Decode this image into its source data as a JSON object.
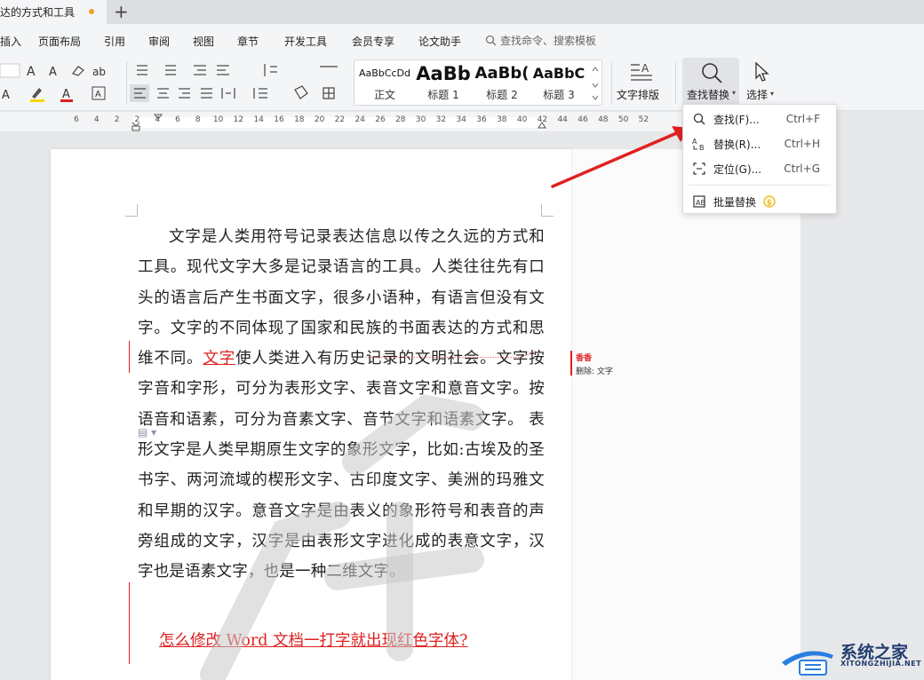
{
  "tab": {
    "title": "达的方式和工具",
    "new_tab": "+"
  },
  "menu": {
    "items": [
      "插入",
      "页面布局",
      "引用",
      "审阅",
      "视图",
      "章节",
      "开发工具",
      "会员专享",
      "论文助手"
    ],
    "search_placeholder": "查找命令、搜索模板"
  },
  "toolbar": {
    "styles": [
      {
        "sample": "AaBbCcDd",
        "name": "正文"
      },
      {
        "sample": "AaBb",
        "name": "标题 1"
      },
      {
        "sample": "AaBb(",
        "name": "标题 2"
      },
      {
        "sample": "AaBbC",
        "name": "标题 3"
      }
    ],
    "text_layout": "文字排版",
    "find_replace": "查找替换",
    "select": "选择"
  },
  "ruler": {
    "ticks": [
      "6",
      "4",
      "2",
      "2",
      "4",
      "6",
      "8",
      "10",
      "12",
      "14",
      "16",
      "18",
      "20",
      "22",
      "24",
      "26",
      "28",
      "30",
      "32",
      "34",
      "36",
      "38",
      "40",
      "42",
      "44",
      "46",
      "48",
      "50",
      "52"
    ]
  },
  "document": {
    "para_before_rev": "文字是人类用符号记录表达信息以传之久远的方式和工具。现代文字大多是记录语言的工具。人类往往先有口头的语言后产生书面文字，很多小语种，有语言但没有文字。文字的不同体现了国家和民族的书面表达的方式和思维不同。",
    "rev_word": "文字",
    "para_after_rev": "使人类进入有历史记录的文明社会。文字按字音和字形，可分为表形文字、表音文字和意音文字。按语音和语素，可分为音素文字、音节文字和语素文字。 表形文字是人类早期原生文字的象形文字，比如:古埃及的圣书字、两河流域的楔形文字、古印度文字、美洲的玛雅文和早期的汉字。意音文字是由表义的象形符号和表音的声旁组成的文字，汉字是由表形文字进化成的表意文字，汉字也是语素文字，也是一种二维文字。",
    "heading": "怎么修改 Word 文档一打字就出现红色字体?"
  },
  "comment": {
    "author": "香香",
    "text": "删除: 文字"
  },
  "dropdown": {
    "items": [
      {
        "icon": "magnifier-icon",
        "label": "查找(F)...",
        "shortcut": "Ctrl+F"
      },
      {
        "icon": "replace-icon",
        "label": "替换(R)...",
        "shortcut": "Ctrl+H"
      },
      {
        "icon": "goto-icon",
        "label": "定位(G)...",
        "shortcut": "Ctrl+G"
      },
      {
        "icon": "batch-replace-icon",
        "label": "批量替换",
        "shortcut": ""
      }
    ]
  },
  "logo": {
    "name": "系统之家",
    "url_text": "XITONGZHIJIA.NET"
  },
  "colors": {
    "revision": "#e02020",
    "arrow": "#e02020",
    "accent_dot": "#f0a020",
    "logo": "#223c6e"
  }
}
